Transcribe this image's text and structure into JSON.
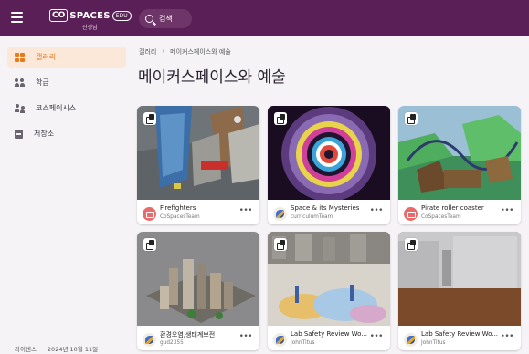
{
  "header": {
    "logo_box": "CO",
    "logo_text": "SPACES",
    "logo_edu": "EDU",
    "logo_sub": "선생님",
    "search_placeholder": "검색"
  },
  "sidebar": {
    "items": [
      {
        "label": "갤러리",
        "icon": "gallery-grid-icon",
        "active": true
      },
      {
        "label": "학급",
        "icon": "class-people-icon",
        "active": false
      },
      {
        "label": "코스페이시스",
        "icon": "cospaces-people-icon",
        "active": false
      },
      {
        "label": "저장소",
        "icon": "storage-icon",
        "active": false
      }
    ],
    "footer": {
      "license": "라이센스",
      "date": "2024년 10월 11일"
    }
  },
  "main": {
    "breadcrumb": [
      "갤러리",
      "메이커스페이스와 예술"
    ],
    "title": "메이커스페이스와 예술",
    "cards": [
      {
        "title": "Firefighters",
        "author": "CoSpacesTeam",
        "avatar": "red"
      },
      {
        "title": "Space & its Mysteries",
        "author": "curriculumTeam",
        "avatar": "blue"
      },
      {
        "title": "Pirate roller coaster",
        "author": "CoSpacesTeam",
        "avatar": "red"
      },
      {
        "title": "환경오염,생태계보전",
        "author": "gud2355",
        "avatar": "blue"
      },
      {
        "title": "Lab Safety Review Wo...",
        "author": "JohnTitus",
        "avatar": "blue"
      },
      {
        "title": "Lab Safety Review Wo...",
        "author": "JohnTitus",
        "avatar": "blue"
      }
    ],
    "more_label": "•••"
  },
  "colors": {
    "topbar": "#5a1f56",
    "accent": "#e97a1c",
    "active_bg": "#fbe8d8"
  }
}
